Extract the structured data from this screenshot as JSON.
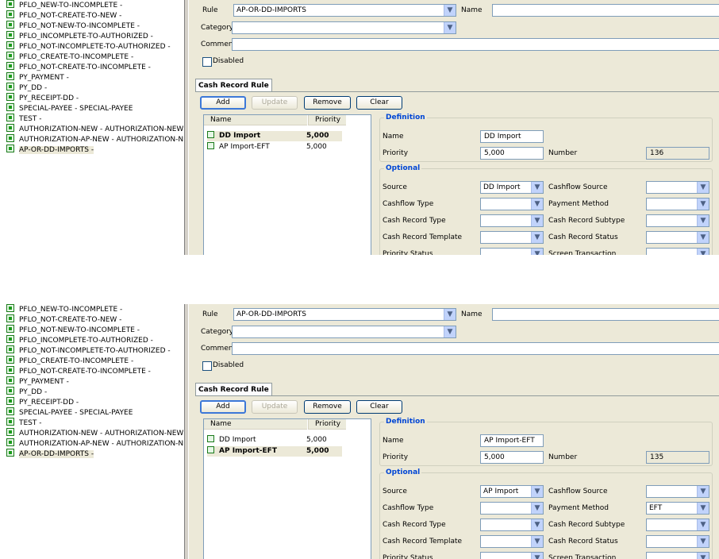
{
  "panels": [
    {
      "tree_items": [
        "PFLO_NEW-TO-INCOMPLETE -",
        "PFLO_NOT-CREATE-TO-NEW -",
        "PFLO_NOT-NEW-TO-INCOMPLETE -",
        "PFLO_INCOMPLETE-TO-AUTHORIZED -",
        "PFLO_NOT-INCOMPLETE-TO-AUTHORIZED -",
        "PFLO_CREATE-TO-INCOMPLETE -",
        "PFLO_NOT-CREATE-TO-INCOMPLETE -",
        "PY_PAYMENT -",
        "PY_DD -",
        "PY_RECEIPT-DD -",
        "SPECIAL-PAYEE - SPECIAL-PAYEE",
        "TEST -",
        "AUTHORIZATION-NEW - AUTHORIZATION-NEW",
        "AUTHORIZATION-AP-NEW - AUTHORIZATION-NEW",
        "AP-OR-DD-IMPORTS -"
      ],
      "rule_label": "Rule",
      "rule_value": "AP-OR-DD-IMPORTS",
      "name_label": "Name",
      "name_value": "",
      "category_label": "Category",
      "category_value": "",
      "comment_label": "Comment",
      "comment_value": "",
      "disabled_label": "Disabled",
      "tab_label": "Cash Record Rule",
      "buttons": {
        "add": "Add",
        "update": "Update",
        "remove": "Remove",
        "clear": "Clear"
      },
      "list_headers": {
        "name": "Name",
        "priority": "Priority"
      },
      "list_rows": [
        {
          "name": "DD Import",
          "priority": "5,000"
        },
        {
          "name": "AP Import-EFT",
          "priority": "5,000"
        }
      ],
      "selected_row": 0,
      "definition_title": "Definition",
      "def_name_label": "Name",
      "def_name_value": "DD Import",
      "priority_label": "Priority",
      "priority_value": "5,000",
      "number_label": "Number",
      "number_value": "136",
      "optional_title": "Optional",
      "source_label": "Source",
      "source_value": "DD Import",
      "cashflow_source_label": "Cashflow Source",
      "cashflow_source_value": "",
      "cashflow_type_label": "Cashflow Type",
      "cashflow_type_value": "",
      "payment_method_label": "Payment Method",
      "payment_method_value": "",
      "cash_record_type_label": "Cash Record Type",
      "cash_record_type_value": "",
      "cash_record_subtype_label": "Cash Record Subtype",
      "cash_record_subtype_value": "",
      "cash_record_template_label": "Cash Record Template",
      "cash_record_template_value": "",
      "cash_record_status_label": "Cash Record Status",
      "cash_record_status_value": "",
      "priority_status_label": "Priority Status",
      "screen_transaction_label": "Screen Transaction"
    },
    {
      "tree_items": [
        "PFLO_NEW-TO-INCOMPLETE -",
        "PFLO_NOT-CREATE-TO-NEW -",
        "PFLO_NOT-NEW-TO-INCOMPLETE -",
        "PFLO_INCOMPLETE-TO-AUTHORIZED -",
        "PFLO_NOT-INCOMPLETE-TO-AUTHORIZED -",
        "PFLO_CREATE-TO-INCOMPLETE -",
        "PFLO_NOT-CREATE-TO-INCOMPLETE -",
        "PY_PAYMENT -",
        "PY_DD -",
        "PY_RECEIPT-DD -",
        "SPECIAL-PAYEE - SPECIAL-PAYEE",
        "TEST -",
        "AUTHORIZATION-NEW - AUTHORIZATION-NEW",
        "AUTHORIZATION-AP-NEW - AUTHORIZATION-NEW",
        "AP-OR-DD-IMPORTS -"
      ],
      "rule_label": "Rule",
      "rule_value": "AP-OR-DD-IMPORTS",
      "name_label": "Name",
      "name_value": "",
      "category_label": "Category",
      "category_value": "",
      "comment_label": "Comment",
      "comment_value": "",
      "disabled_label": "Disabled",
      "tab_label": "Cash Record Rule",
      "buttons": {
        "add": "Add",
        "update": "Update",
        "remove": "Remove",
        "clear": "Clear"
      },
      "list_headers": {
        "name": "Name",
        "priority": "Priority"
      },
      "list_rows": [
        {
          "name": "DD Import",
          "priority": "5,000"
        },
        {
          "name": "AP Import-EFT",
          "priority": "5,000"
        }
      ],
      "selected_row": 1,
      "definition_title": "Definition",
      "def_name_label": "Name",
      "def_name_value": "AP Import-EFT",
      "priority_label": "Priority",
      "priority_value": "5,000",
      "number_label": "Number",
      "number_value": "135",
      "optional_title": "Optional",
      "source_label": "Source",
      "source_value": "AP Import",
      "cashflow_source_label": "Cashflow Source",
      "cashflow_source_value": "",
      "cashflow_type_label": "Cashflow Type",
      "cashflow_type_value": "",
      "payment_method_label": "Payment Method",
      "payment_method_value": "EFT",
      "cash_record_type_label": "Cash Record Type",
      "cash_record_type_value": "",
      "cash_record_subtype_label": "Cash Record Subtype",
      "cash_record_subtype_value": "",
      "cash_record_template_label": "Cash Record Template",
      "cash_record_template_value": "",
      "cash_record_status_label": "Cash Record Status",
      "cash_record_status_value": "",
      "priority_status_label": "Priority Status",
      "screen_transaction_label": "Screen Transaction"
    }
  ]
}
